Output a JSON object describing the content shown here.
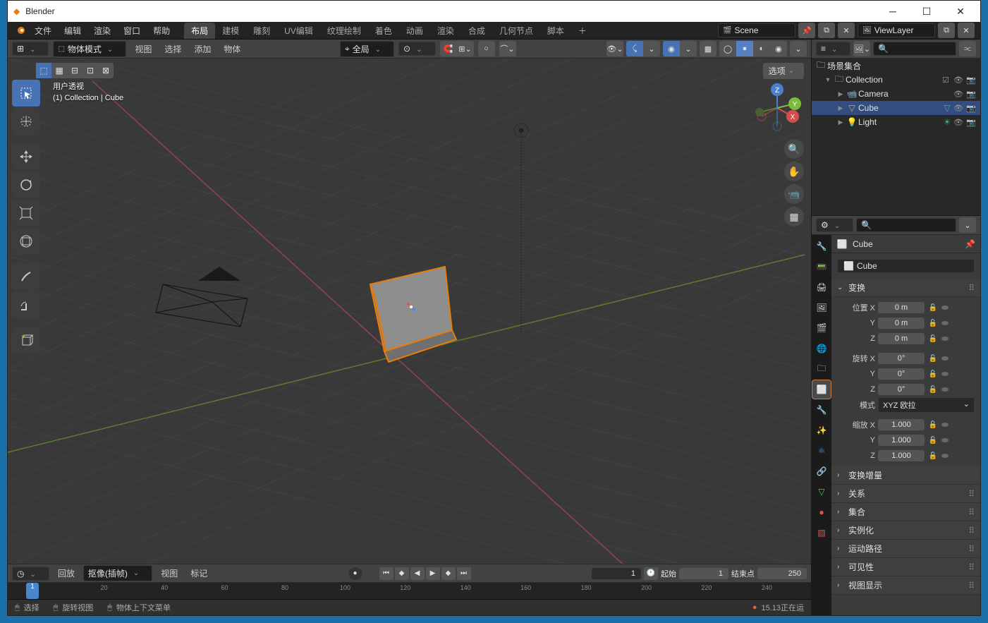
{
  "titlebar": {
    "app": "Blender"
  },
  "menu": {
    "file": "文件",
    "edit": "编辑",
    "render": "渲染",
    "window": "窗口",
    "help": "帮助"
  },
  "workspaces": {
    "items": [
      "布局",
      "建模",
      "雕刻",
      "UV编辑",
      "纹理绘制",
      "着色",
      "动画",
      "渲染",
      "合成",
      "几何节点",
      "脚本"
    ],
    "active": "布局"
  },
  "scene": {
    "label": "Scene",
    "viewlayer": "ViewLayer"
  },
  "viewport_header": {
    "mode": "物体模式",
    "menu": {
      "view": "视图",
      "select": "选择",
      "add": "添加",
      "object": "物体"
    },
    "orientation": "全局",
    "options": "选项"
  },
  "viewport_info": {
    "perspective": "用户透视",
    "collection": "(1) Collection | Cube"
  },
  "timeline": {
    "play": "回放",
    "keying": "抠像(插帧)",
    "view": "视图",
    "marker": "标记",
    "current": 1,
    "start_label": "起始",
    "start": 1,
    "end_label": "结束点",
    "end": 250,
    "ticks": [
      20,
      40,
      60,
      80,
      100,
      120,
      140,
      160,
      180,
      200,
      220,
      240
    ]
  },
  "statusbar": {
    "select": "选择",
    "rotate": "旋转视图",
    "context": "物体上下文菜单",
    "version": "15.13正在运"
  },
  "outliner": {
    "scene_collection": "场景集合",
    "collection": "Collection",
    "items": [
      {
        "name": "Camera",
        "icon": "camera"
      },
      {
        "name": "Cube",
        "icon": "mesh",
        "selected": true
      },
      {
        "name": "Light",
        "icon": "light"
      }
    ]
  },
  "properties": {
    "breadcrumb": "Cube",
    "name": "Cube",
    "panels": {
      "transform": {
        "title": "变换",
        "loc_label": "位置",
        "rot_label": "旋转",
        "scale_label": "缩放",
        "loc": {
          "x": "0 m",
          "y": "0 m",
          "z": "0 m"
        },
        "rot": {
          "x": "0°",
          "y": "0°",
          "z": "0°"
        },
        "scale": {
          "x": "1.000",
          "y": "1.000",
          "z": "1.000"
        },
        "mode_label": "模式",
        "mode": "XYZ 欧拉"
      },
      "delta": "变换增量",
      "relations": "关系",
      "collections": "集合",
      "instancing": "实例化",
      "motion_paths": "运动路径",
      "visibility": "可见性",
      "viewport_display": "视图显示"
    }
  }
}
